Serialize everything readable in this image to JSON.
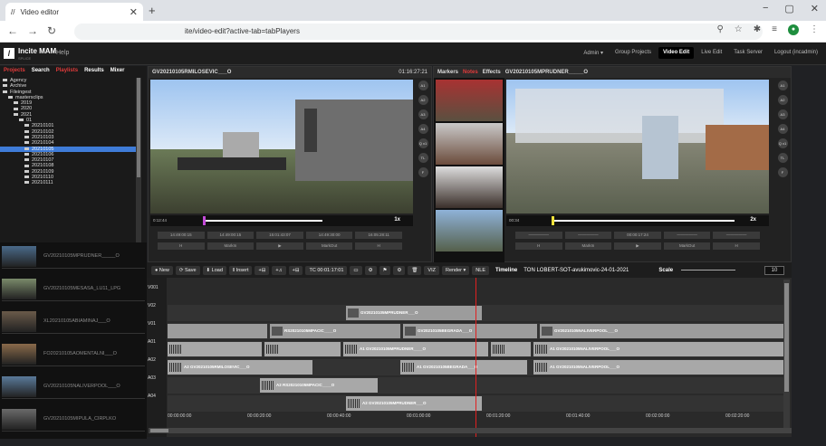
{
  "browser": {
    "tab_title": "Video editor",
    "url": "ite/video-edit?active-tab=tabPlayers",
    "win_controls": [
      "−",
      "▢",
      "✕"
    ]
  },
  "app": {
    "name": "Incite MAM",
    "subtitle": "SPLICE",
    "help": "Help",
    "nav": [
      "Admin ▾",
      "Group Projects",
      "Video Edit",
      "Live Edit",
      "Task Server",
      "Logout (incadmin)"
    ],
    "active_nav": "Video Edit"
  },
  "left": {
    "tabs": [
      "Projects",
      "Search",
      "Playlists",
      "Results",
      "Mixer"
    ],
    "tree": [
      {
        "label": "Agency",
        "indent": 0
      },
      {
        "label": "Archive",
        "indent": 0
      },
      {
        "label": "Fileingest",
        "indent": 0
      },
      {
        "label": "mastersclips",
        "indent": 1
      },
      {
        "label": "2019",
        "indent": 2
      },
      {
        "label": "2020",
        "indent": 2
      },
      {
        "label": "2021",
        "indent": 2
      },
      {
        "label": "01",
        "indent": 3
      },
      {
        "label": "20210101",
        "indent": 4
      },
      {
        "label": "20210102",
        "indent": 4
      },
      {
        "label": "20210103",
        "indent": 4
      },
      {
        "label": "20210104",
        "indent": 4
      },
      {
        "label": "20210105",
        "indent": 4,
        "selected": true
      },
      {
        "label": "20210106",
        "indent": 4
      },
      {
        "label": "20210107",
        "indent": 4
      },
      {
        "label": "20210108",
        "indent": 4
      },
      {
        "label": "20210109",
        "indent": 4
      },
      {
        "label": "20210110",
        "indent": 4
      },
      {
        "label": "20210111",
        "indent": 4
      }
    ],
    "clips": [
      "GV20210105MPRUDNER_____O",
      "GV20210105MESASA_LU11_LPG",
      "XL20210105ABIAMINAJ___O",
      "FO20210105AOMENTALNI___O",
      "GV20210105NALIVERPOOL___O",
      "GV20210105MIPULA_CIRPLKO"
    ]
  },
  "player_left": {
    "title": "GV20210105RMILOSEVIC___O",
    "tc": "01:16:27:21",
    "timeline_label": "0:12:44",
    "ctrl_top": [
      "14:49:00:15",
      "14:49:00:15",
      "15:01:43:07",
      "14:49:30:00",
      "16:05:28:11"
    ],
    "ctrl_bottom": [
      "H",
      "MarkIn",
      "▶",
      "MarkOut",
      "H"
    ],
    "speed": "1x"
  },
  "player_right": {
    "tabs": [
      "Markers",
      "Notes",
      "Effects"
    ],
    "title": "GV20210105MPRUDNER_____O",
    "timeline_label": "00:34",
    "ctrl_top": [
      "—————",
      "—————",
      "00:00:17:24",
      "—————",
      "—————"
    ],
    "ctrl_bottom": [
      "H",
      "MarkIn",
      "▶",
      "MarkOut",
      "H"
    ],
    "speed": "2x"
  },
  "side_buttons": [
    "A1",
    "A2",
    "A3",
    "A4",
    "Q x1",
    "TL",
    "F"
  ],
  "toolbar": {
    "buttons": [
      "● New",
      "⟳ Save",
      "⬇ Load",
      "‖ Insert",
      "+⊟",
      "+♫",
      "+⊟",
      "TC 00:01:17:01",
      "▭",
      "⚙",
      "⚑",
      "⚙",
      "🗑",
      "VIZ",
      "Render ▾",
      "NLE"
    ],
    "timeline_label": "Timeline",
    "timeline_name": "TON LOBERT-SOT-avukimovic-24-01-2021",
    "scale_label": "Scale",
    "scale_value": "10"
  },
  "tracks": [
    "V001",
    "V02",
    "V01",
    "A01",
    "A02",
    "A03",
    "A04"
  ],
  "segments": {
    "v02": "GV20210105MPRUDNER___O",
    "v01a": "RS20210105MPACIC____O",
    "v01b": "GV20210105BEGRADA___O",
    "v01c": "GV20210105NALIVERPOOL___O",
    "a01a": "A1 GV20210105MPRUDNER____O",
    "a01b": "A1 GV20210105NALIVERPOOL___O",
    "a02a": "A2 GV20210105RMILOSEVIC___O",
    "a02b": "A1 GV20210105BEGRADA___O",
    "a02c": "A1 GV20210105NALIVERPOOL___O",
    "a03": "A2 RS20210105MPACIC____O",
    "a04": "A2 GV20210105MPRUDNER___O"
  },
  "ruler": [
    "00:00:00:00",
    "00:00:20:00",
    "00:00:40:00",
    "00:01:00:00",
    "00:01:20:00",
    "00:01:40:00",
    "00:02:00:00",
    "00:02:20:00"
  ]
}
